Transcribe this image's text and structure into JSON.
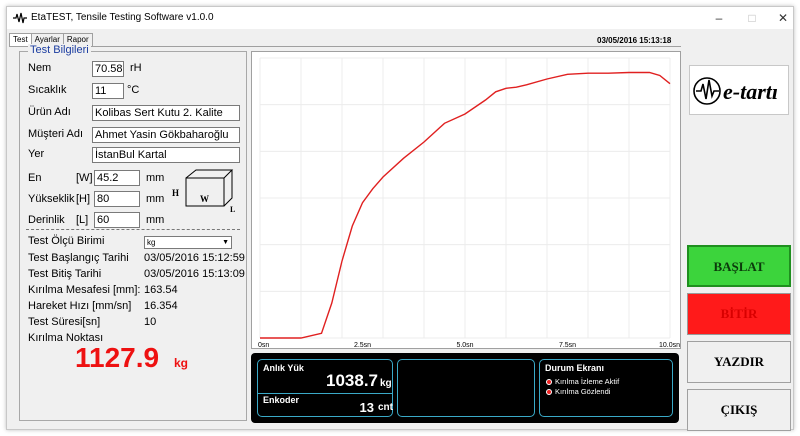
{
  "window": {
    "title": "EtaTEST, Tensile Testing Software v1.0.0",
    "minimize": "–",
    "maximize": "□",
    "close": "✕"
  },
  "tabs": [
    {
      "label": "Test",
      "active": true
    },
    {
      "label": "Ayarlar",
      "active": false
    },
    {
      "label": "Rapor",
      "active": false
    }
  ],
  "datetime": "03/05/2016 15:13:18",
  "test_info": {
    "group_title": "Test Bilgileri",
    "humidity_label": "Nem",
    "humidity_value": "70.58",
    "humidity_unit": "rH",
    "temperature_label": "Sıcaklık",
    "temperature_value": "11",
    "temperature_unit": "°C",
    "product_label": "Ürün Adı",
    "product_value": "Kolibas Sert Kutu 2. Kalite",
    "customer_label": "Müşteri Adı",
    "customer_value": "Ahmet Yasin Gökbaharoğlu",
    "location_label": "Yer",
    "location_value": "İstanBul Kartal",
    "width_label": "En",
    "width_code": "[W]",
    "width_value": "45.2",
    "width_unit": "mm",
    "height_label": "Yükseklik",
    "height_code": "[H]",
    "height_value": "80",
    "height_unit": "mm",
    "depth_label": "Derinlik",
    "depth_code": "[L]",
    "depth_value": "60",
    "depth_unit": "mm",
    "box_h": "H",
    "box_w": "W",
    "box_l": "L"
  },
  "results": {
    "unit_label": "Test Ölçü Birimi",
    "unit_value": "kg",
    "start_label": "Test Başlangıç Tarihi",
    "start_value": "03/05/2016 15:12:59",
    "end_label": "Test Bitiş Tarihi",
    "end_value": "03/05/2016 15:13:09",
    "distance_label": "Kırılma  Mesafesi [mm]:",
    "distance_value": "163.54",
    "speed_label": "Hareket Hızı [mm/sn]",
    "speed_value": "16.354",
    "duration_label": "Test Süresi[sn]",
    "duration_value": "10",
    "break_label": "Kırılma Noktası",
    "break_value": "1127.9",
    "break_unit": "kg"
  },
  "chart_data": {
    "type": "line",
    "x_ticks": [
      "0sn",
      "2.5sn",
      "5.0sn",
      "7.5sn",
      "10.0sn"
    ],
    "xlim": [
      0,
      10
    ],
    "ylim": [
      0,
      1200
    ],
    "grid": true,
    "line_color": "#e02020",
    "series": [
      {
        "x": [
          0,
          0.5,
          1.0,
          1.5,
          1.75,
          2.0,
          2.25,
          2.5,
          2.75,
          3.0,
          3.5,
          4.0,
          4.5,
          5.0,
          5.5,
          5.75,
          6.0,
          6.25,
          6.5,
          7.0,
          7.5,
          8.0,
          8.5,
          9.0,
          9.5,
          9.75,
          10.0
        ],
        "y": [
          0,
          0,
          0,
          20,
          150,
          330,
          480,
          580,
          640,
          690,
          770,
          840,
          920,
          960,
          1020,
          1055,
          1070,
          1075,
          1085,
          1110,
          1130,
          1135,
          1135,
          1138,
          1138,
          1125,
          1090
        ]
      }
    ]
  },
  "live": {
    "instant_load_label": "Anlık Yük",
    "instant_load_value": "1038.7",
    "instant_load_unit": "kg",
    "encoder_label": "Enkoder",
    "encoder_value": "13",
    "encoder_unit": "cnt",
    "status_title": "Durum Ekranı",
    "status_items": [
      "Kırılma İzleme Aktif",
      "Kırılma Gözlendi"
    ],
    "status_color": "#e22222",
    "accent_color": "#3aa9c7"
  },
  "logo": {
    "text": "e-tartı",
    "icon": "pulse-wave-icon"
  },
  "buttons": {
    "start": "BAŞLAT",
    "stop": "BİTİR",
    "print": "YAZDIR",
    "exit": "ÇIKIŞ",
    "start_color": "#3cd43c",
    "stop_color": "#ff1a1a"
  }
}
